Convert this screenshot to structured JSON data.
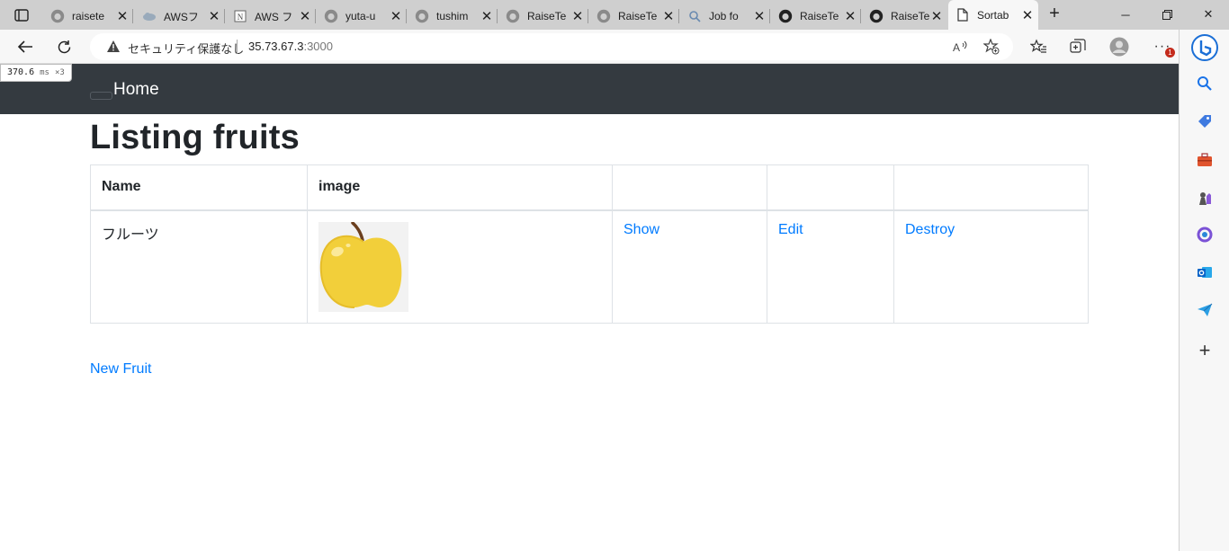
{
  "browser": {
    "tabs": [
      {
        "title": "raisete",
        "icon": "github-icon"
      },
      {
        "title": "AWSフ",
        "icon": "aws-cloud-icon"
      },
      {
        "title": "AWS フ",
        "icon": "notion-icon"
      },
      {
        "title": "yuta-u",
        "icon": "github-icon"
      },
      {
        "title": "tushim",
        "icon": "github-icon"
      },
      {
        "title": "RaiseTe",
        "icon": "github-icon"
      },
      {
        "title": "RaiseTe",
        "icon": "github-icon"
      },
      {
        "title": "Job fo",
        "icon": "search-icon"
      },
      {
        "title": "RaiseTe",
        "icon": "github-icon"
      },
      {
        "title": "RaiseTe",
        "icon": "github-icon"
      },
      {
        "title": "Sortab",
        "icon": "page-icon",
        "active": true
      }
    ],
    "security_text": "セキュリティ保護なし",
    "url_host": "35.73.67.3",
    "url_port": ":3000",
    "notification_count": "1",
    "perf_value": "370.6",
    "perf_unit": "ms",
    "perf_mult": "×3"
  },
  "app": {
    "brand": "Home",
    "page_title": "Listing fruits",
    "table": {
      "headers": [
        "Name",
        "image",
        "",
        "",
        ""
      ],
      "rows": [
        {
          "name": "フルーツ",
          "image": "apple-image",
          "show": "Show",
          "edit": "Edit",
          "destroy": "Destroy"
        }
      ]
    },
    "new_link": "New Fruit"
  },
  "colors": {
    "navbar_bg": "#343a40",
    "link": "#007bff",
    "tabstrip_bg": "#cfcfcf"
  }
}
